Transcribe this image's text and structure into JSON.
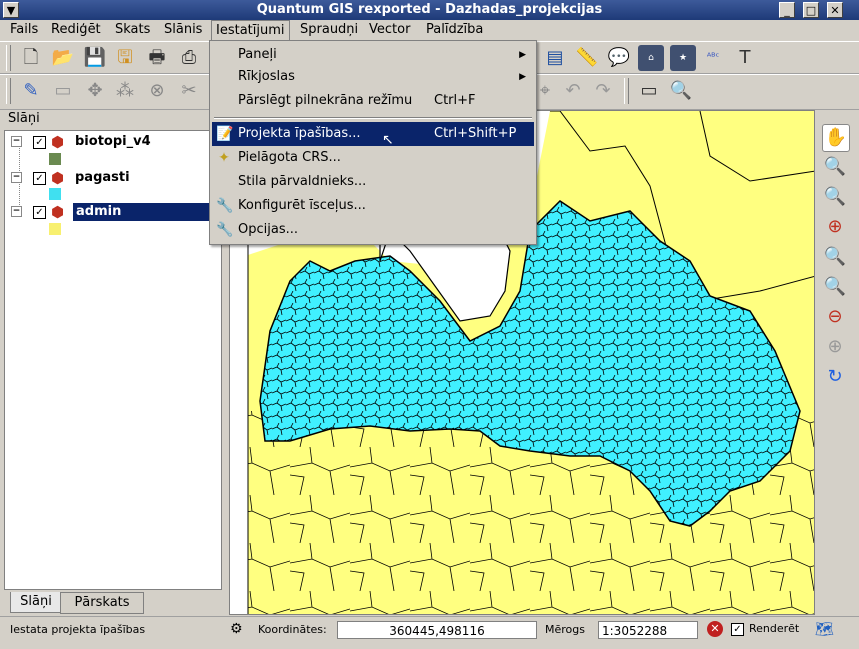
{
  "window": {
    "title": "Quantum GIS rexported - Dazhadas_projekcijas",
    "menu_icon": "down-arrow-icon",
    "buttons": [
      "minimize-icon",
      "maximize-icon",
      "close-icon"
    ]
  },
  "menubar": [
    "Fails",
    "Rediģēt",
    "Skats",
    "Slānis",
    "Iestatījumi",
    "Spraudņi",
    "Vector",
    "Palīdzība"
  ],
  "dropdown": {
    "items": [
      {
        "label": "Paneļi",
        "submenu": true
      },
      {
        "label": "Rīkjoslas",
        "submenu": true
      },
      {
        "label": "Pārslēgt pilnekrāna režīmu",
        "shortcut": "Ctrl+F"
      },
      {
        "label": "Projekta īpašības...",
        "shortcut": "Ctrl+Shift+P",
        "icon": "project-properties-icon",
        "selected": true
      },
      {
        "label": "Pielāgota CRS...",
        "icon": "crs-wand-icon"
      },
      {
        "label": "Stila pārvaldnieks..."
      },
      {
        "label": "Konfigurēt īsceļus...",
        "icon": "wrench-icon"
      },
      {
        "label": "Opcijas...",
        "icon": "wrench-icon"
      }
    ]
  },
  "toolbar_icons": {
    "toolbar1": [
      "new-project-icon",
      "open-project-icon",
      "save-project-icon",
      "save-as-icon",
      "print-composer-icon",
      "print-icon"
    ],
    "toolbar1_right": [
      "attribute-table-icon",
      "measure-icon",
      "annotation-icon",
      "home-icon",
      "home-star-icon",
      "label-abc-icon",
      "text-annotation-icon"
    ],
    "toolbar2": [
      "edit-pencil-icon",
      "save-edits-icon",
      "move-feature-icon",
      "node-tool-icon",
      "delete-selected-icon",
      "cut-features-icon"
    ],
    "toolbar2_right": [
      "deselect-icon",
      "undo-icon",
      "redo-icon",
      "identify-icon",
      "zoom-search-icon"
    ]
  },
  "layers_panel": {
    "title": "Slāņi",
    "layers": [
      {
        "name": "biotopi_v4",
        "checked": true,
        "symbol_color": "#6a8a50",
        "selected": false
      },
      {
        "name": "pagasti",
        "checked": true,
        "symbol_color": "#40e0f0",
        "selected": false
      },
      {
        "name": "admin",
        "checked": true,
        "symbol_color": "#f8f070",
        "selected": true
      }
    ],
    "tabs": [
      "Slāņi",
      "Pārskats"
    ]
  },
  "map_tools": [
    "pan-hand-icon",
    "zoom-in-icon",
    "zoom-out-icon",
    "zoom-full-icon",
    "zoom-selection-icon",
    "zoom-layer-icon",
    "zoom-last-icon",
    "zoom-next-icon",
    "refresh-icon"
  ],
  "statusbar": {
    "message": "Iestata projekta īpašības",
    "coords_label": "Koordinātes:",
    "coords_value": "360445,498116",
    "scale_label": "Mērogs",
    "scale_value": "1:3052288",
    "render_label": "Renderēt",
    "render_checked": true
  },
  "colors": {
    "map_cyan": "#40f0ff",
    "map_yellow": "#ffff80",
    "selection_blue": "#0a246a",
    "titlebar": "#1e3a78"
  }
}
